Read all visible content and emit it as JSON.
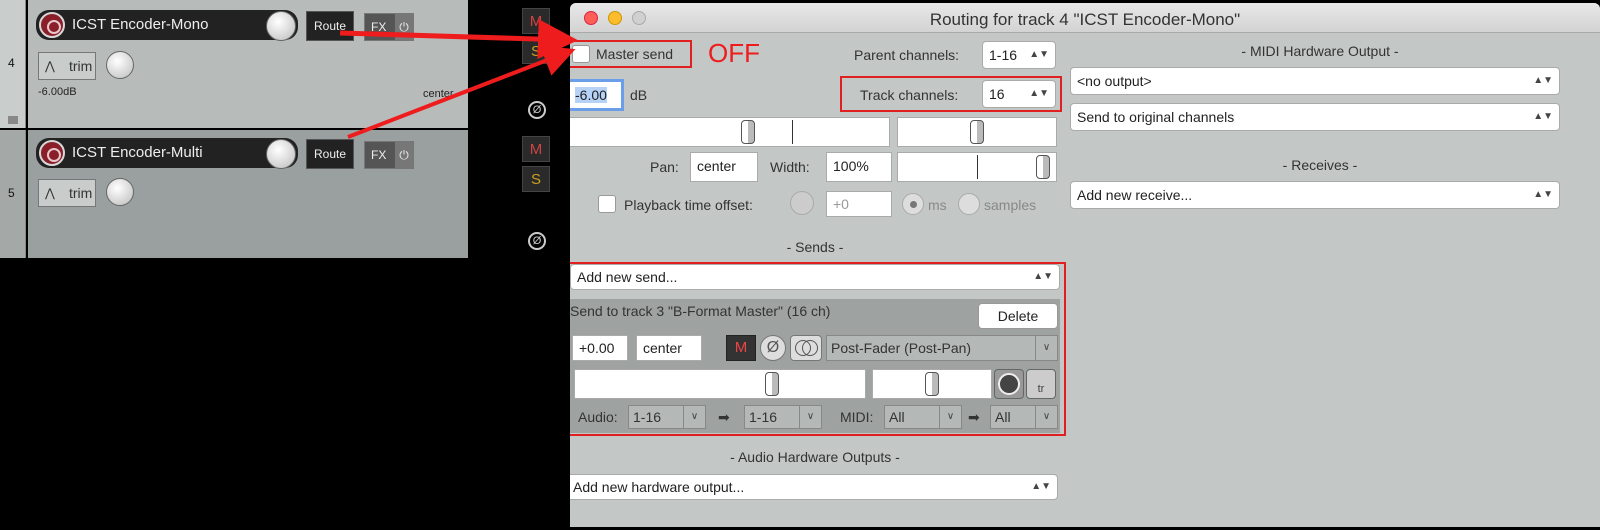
{
  "tracks": [
    {
      "num": "4",
      "name": "ICST Encoder-Mono",
      "route": "Route",
      "fx": "FX",
      "power": "⏻",
      "trim": "trim",
      "volume": "-6.00dB",
      "pan": "center",
      "m": "M",
      "s": "S"
    },
    {
      "num": "5",
      "name": "ICST Encoder-Multi",
      "route": "Route",
      "fx": "FX",
      "power": "⏻",
      "trim": "trim",
      "m": "M",
      "s": "S"
    }
  ],
  "phase_glyph": "Ø",
  "window": {
    "title": "Routing for track 4 \"ICST Encoder-Mono\"",
    "master_send": "Master send",
    "off_label": "OFF",
    "parent_channels_label": "Parent channels:",
    "parent_channels": "1-16",
    "track_channels_label": "Track channels:",
    "track_channels": "16",
    "volume": "-6.00",
    "volume_unit": "dB",
    "pan_label": "Pan:",
    "pan": "center",
    "width_label": "Width:",
    "width": "100%",
    "playback_offset_label": "Playback time offset:",
    "offset": "+0",
    "ms": "ms",
    "samples": "samples",
    "sends_header": "- Sends -",
    "add_send": "Add new send...",
    "send_title": "Send to track 3 \"B-Format Master\" (16 ch)",
    "delete": "Delete",
    "send_vol": "+0.00",
    "send_pan": "center",
    "send_mute": "M",
    "send_mode": "Post-Fader (Post-Pan)",
    "audio_label": "Audio:",
    "audio_src": "1-16",
    "audio_dst": "1-16",
    "midi_label": "MIDI:",
    "midi_src": "All",
    "midi_dst": "All",
    "arrow": "➡",
    "hw_header": "- Audio Hardware Outputs -",
    "add_hw": "Add new hardware output...",
    "midi_hw_header": "- MIDI Hardware Output -",
    "midi_output": "<no output>",
    "midi_channels": "Send to original channels",
    "receives_header": "- Receives -",
    "add_receive": "Add new receive...",
    "tr_label": "tr"
  },
  "colors": {
    "annotation": "#e02020",
    "close": "#fc5f57",
    "minimize": "#fdbc2e",
    "zoom": "#d0d0d0"
  }
}
